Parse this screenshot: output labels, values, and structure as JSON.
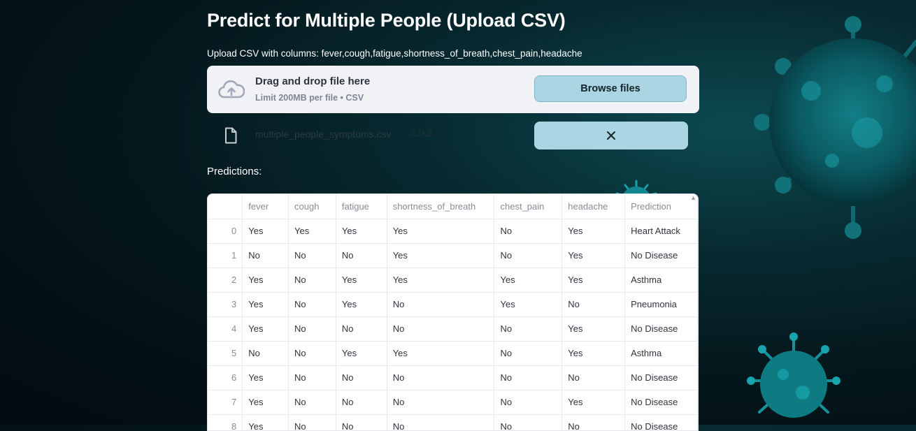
{
  "page": {
    "title": "Predict for Multiple People (Upload CSV)",
    "upload_label": "Upload CSV with columns: fever,cough,fatigue,shortness_of_breath,chest_pain,headache"
  },
  "uploader": {
    "drop_title": "Drag and drop file here",
    "limit_text": "Limit 200MB per file • CSV",
    "browse_label": "Browse files",
    "icon": "cloud-upload-icon",
    "file": {
      "name": "multiple_people_symptoms.csv",
      "size": "2.1KB",
      "icon": "file-icon",
      "remove_icon": "close-icon"
    }
  },
  "predictions": {
    "label": "Predictions:",
    "columns": [
      "",
      "fever",
      "cough",
      "fatigue",
      "shortness_of_breath",
      "chest_pain",
      "headache",
      "Prediction"
    ],
    "rows": [
      [
        "0",
        "Yes",
        "Yes",
        "Yes",
        "Yes",
        "No",
        "Yes",
        "Heart Attack"
      ],
      [
        "1",
        "No",
        "No",
        "No",
        "Yes",
        "No",
        "Yes",
        "No Disease"
      ],
      [
        "2",
        "Yes",
        "No",
        "Yes",
        "Yes",
        "Yes",
        "Yes",
        "Asthma"
      ],
      [
        "3",
        "Yes",
        "No",
        "Yes",
        "No",
        "Yes",
        "No",
        "Pneumonia"
      ],
      [
        "4",
        "Yes",
        "No",
        "No",
        "No",
        "No",
        "Yes",
        "No Disease"
      ],
      [
        "5",
        "No",
        "No",
        "Yes",
        "Yes",
        "No",
        "Yes",
        "Asthma"
      ],
      [
        "6",
        "Yes",
        "No",
        "No",
        "No",
        "No",
        "No",
        "No Disease"
      ],
      [
        "7",
        "Yes",
        "No",
        "No",
        "No",
        "No",
        "Yes",
        "No Disease"
      ],
      [
        "8",
        "Yes",
        "No",
        "No",
        "No",
        "No",
        "No",
        "No Disease"
      ]
    ]
  },
  "colors": {
    "button_bg": "#acd5e3",
    "dropzone_bg": "#f0f2f6",
    "background": "#04161b"
  }
}
